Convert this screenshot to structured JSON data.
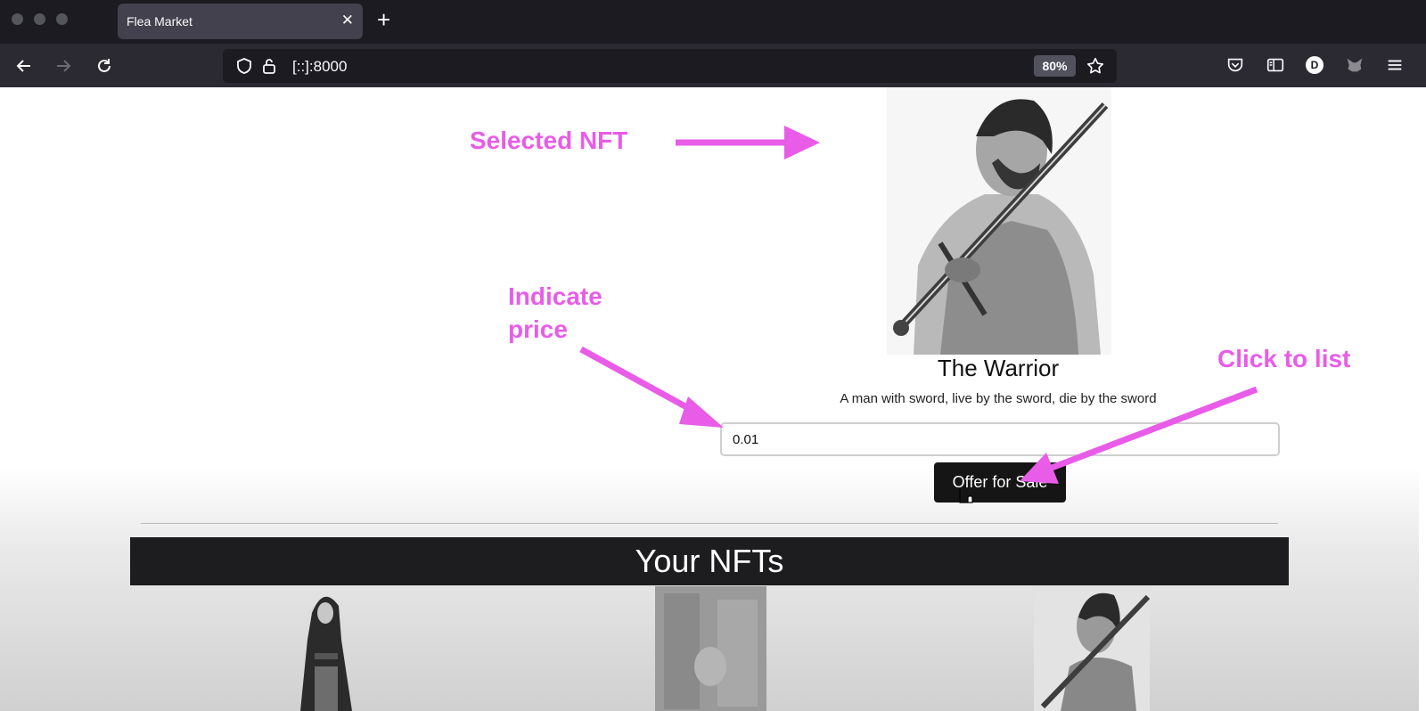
{
  "browser": {
    "tab_title": "Flea Market",
    "url": "[::]:8000",
    "zoom": "80%",
    "profile_initial": "D"
  },
  "nft": {
    "name": "The Warrior",
    "description": "A man with sword, live by the sword, die by the sword",
    "price_value": "0.01",
    "offer_label": "Offer for Sale"
  },
  "collection": {
    "header": "Your NFTs"
  },
  "annotations": {
    "selected": "Selected NFT",
    "indicate_line1": "Indicate",
    "indicate_line2": "price",
    "click": "Click to list"
  },
  "colors": {
    "annotation": "#e85ce8",
    "chrome_dark": "#1c1b22",
    "button_dark": "#151515"
  }
}
